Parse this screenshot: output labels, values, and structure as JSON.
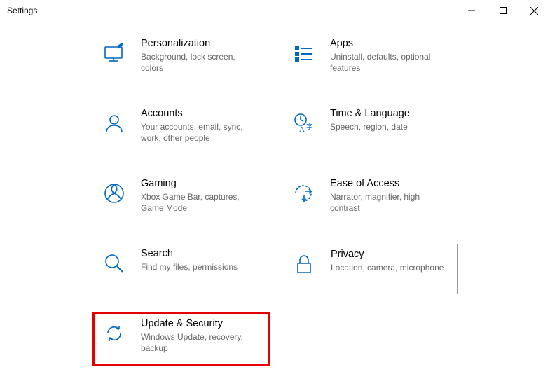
{
  "window": {
    "title": "Settings"
  },
  "categories": [
    {
      "icon": "personalization-icon",
      "title": "Personalization",
      "desc": "Background, lock screen, colors"
    },
    {
      "icon": "apps-icon",
      "title": "Apps",
      "desc": "Uninstall, defaults, optional features"
    },
    {
      "icon": "accounts-icon",
      "title": "Accounts",
      "desc": "Your accounts, email, sync, work, other people"
    },
    {
      "icon": "time-language-icon",
      "title": "Time & Language",
      "desc": "Speech, region, date"
    },
    {
      "icon": "gaming-icon",
      "title": "Gaming",
      "desc": "Xbox Game Bar, captures, Game Mode"
    },
    {
      "icon": "ease-of-access-icon",
      "title": "Ease of Access",
      "desc": "Narrator, magnifier, high contrast"
    },
    {
      "icon": "search-icon",
      "title": "Search",
      "desc": "Find my files, permissions"
    },
    {
      "icon": "privacy-icon",
      "title": "Privacy",
      "desc": "Location, camera, microphone"
    },
    {
      "icon": "update-security-icon",
      "title": "Update & Security",
      "desc": "Windows Update, recovery, backup"
    }
  ]
}
